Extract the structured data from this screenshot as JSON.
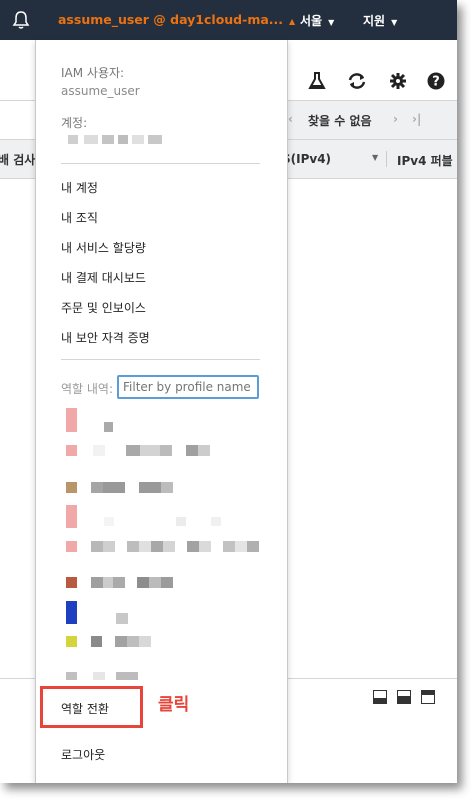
{
  "topbar": {
    "account_label": "assume_user @ day1cloud-ma...",
    "region_label": "서울",
    "support_label": "지원",
    "caret": "▲",
    "nav_caret": "▼"
  },
  "background": {
    "pager_prev": "‹",
    "pager_text": "찾을 수 없음",
    "pager_next": "›",
    "pager_last": "›|",
    "col_partial": "S(IPv4)",
    "col_ipv4": "IPv4 퍼블",
    "left_header": "배 검사",
    "sort_caret": "▼"
  },
  "dropdown": {
    "iam_user_label": "IAM 사용자:",
    "iam_user_value": "assume_user",
    "account_label": "계정:",
    "menu_items": [
      "내 계정",
      "내 조직",
      "내 서비스 할당량",
      "내 결제 대시보드",
      "주문 및 인보이스",
      "내 보안 자격 증명"
    ],
    "role_history_label": "역할 내역:",
    "filter_placeholder": "Filter by profile name",
    "switch_role_label": "역할 전환",
    "logout_label": "로그아웃"
  },
  "annotation": {
    "click_label": "클릭",
    "color": "#e8443a"
  },
  "colors": {
    "topbar_bg": "#232f3e",
    "accent_orange": "#ec7211"
  },
  "icons": [
    "bell-icon",
    "flask-icon",
    "refresh-icon",
    "gear-icon",
    "help-icon",
    "layout-icon"
  ]
}
